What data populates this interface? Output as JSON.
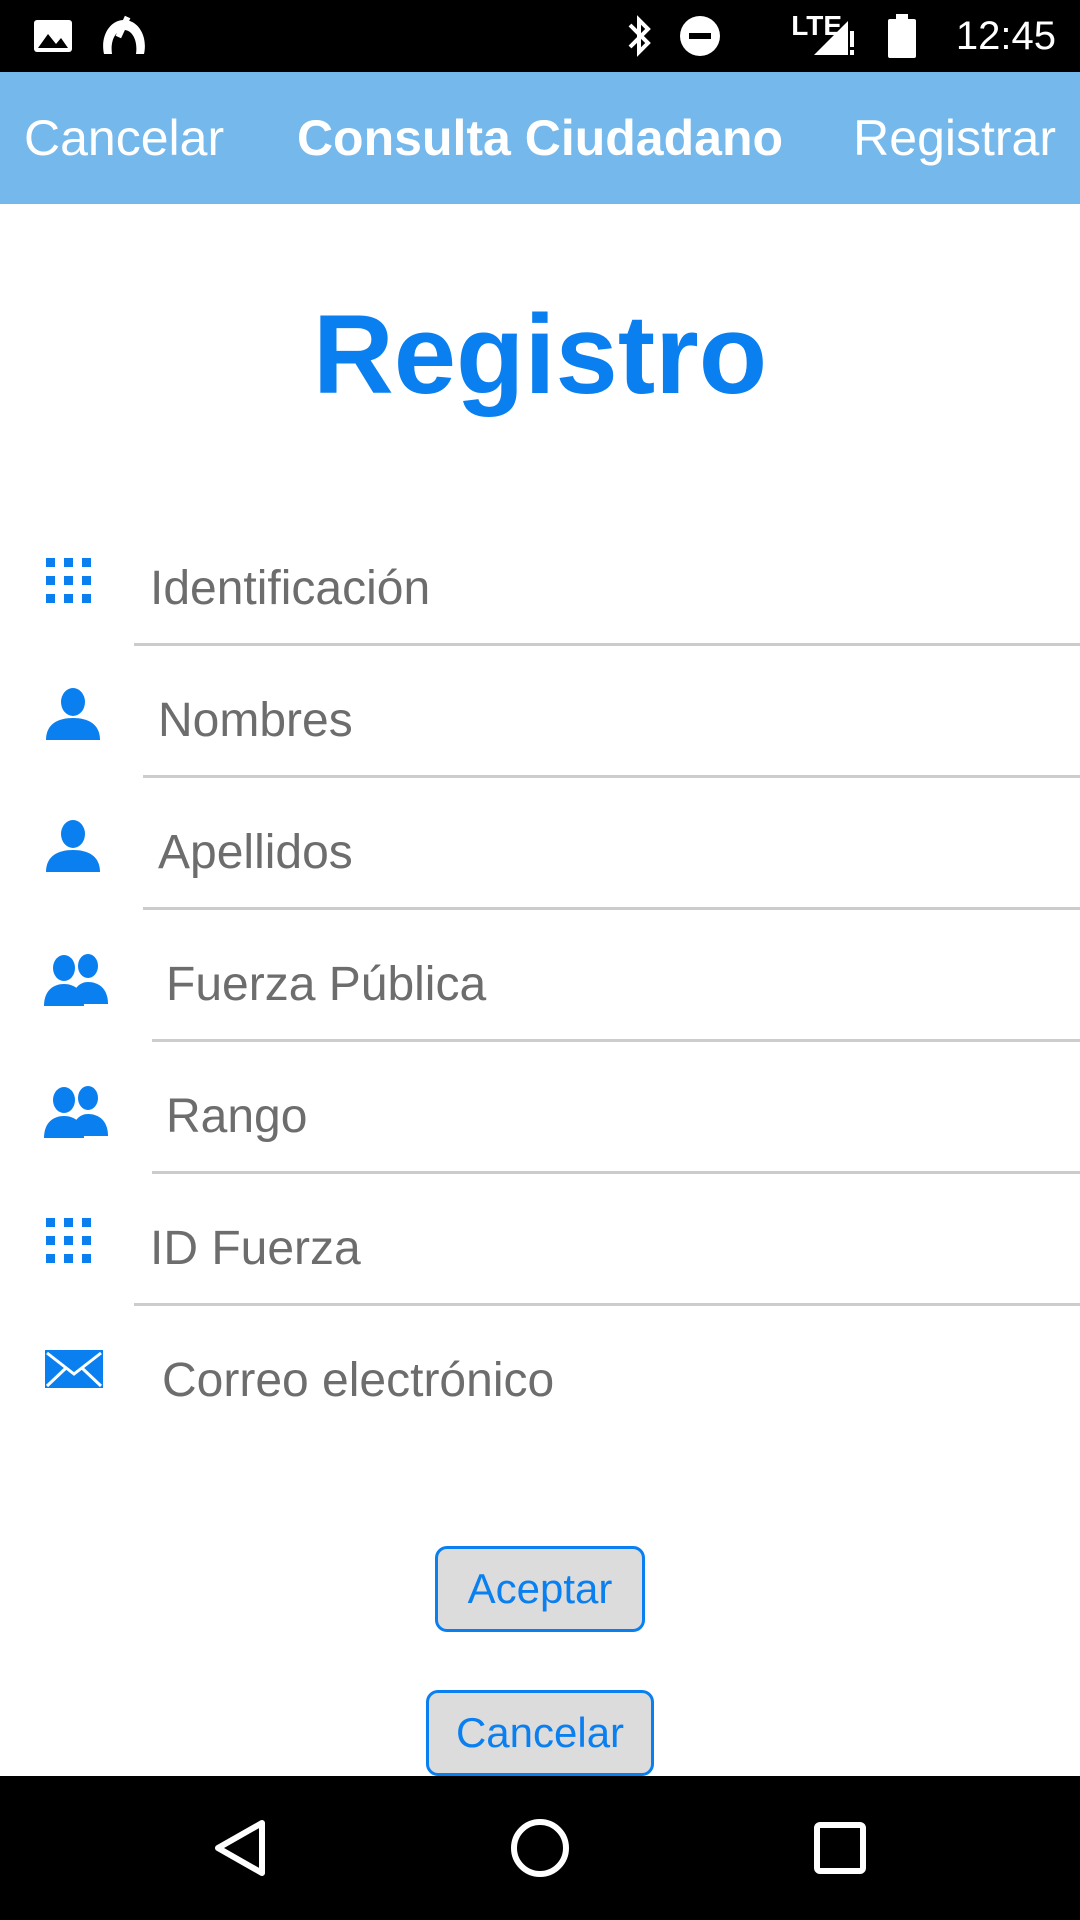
{
  "status_bar": {
    "time": "12:45",
    "network": "LTE",
    "icons": [
      "image-icon",
      "app-notification-icon",
      "bluetooth-icon",
      "do-not-disturb-icon",
      "signal-icon",
      "battery-icon"
    ]
  },
  "nav_bar": {
    "left_label": "Cancelar",
    "title": "Consulta Ciudadano",
    "right_label": "Registrar",
    "background_color": "#75b8ec"
  },
  "page": {
    "title": "Registro",
    "accent_color": "#0a7ff0"
  },
  "form": {
    "fields": [
      {
        "placeholder": "Identificación",
        "icon": "keypad-icon"
      },
      {
        "placeholder": "Nombres",
        "icon": "person-icon"
      },
      {
        "placeholder": "Apellidos",
        "icon": "person-icon"
      },
      {
        "placeholder": "Fuerza Pública",
        "icon": "group-icon"
      },
      {
        "placeholder": "Rango",
        "icon": "group-icon"
      },
      {
        "placeholder": "ID Fuerza",
        "icon": "keypad-icon"
      },
      {
        "placeholder": "Correo electrónico",
        "icon": "envelope-icon"
      }
    ]
  },
  "buttons": {
    "accept_label": "Aceptar",
    "cancel_label": "Cancelar"
  },
  "system_nav": {
    "icons": [
      "back-icon",
      "home-icon",
      "recents-icon"
    ]
  }
}
